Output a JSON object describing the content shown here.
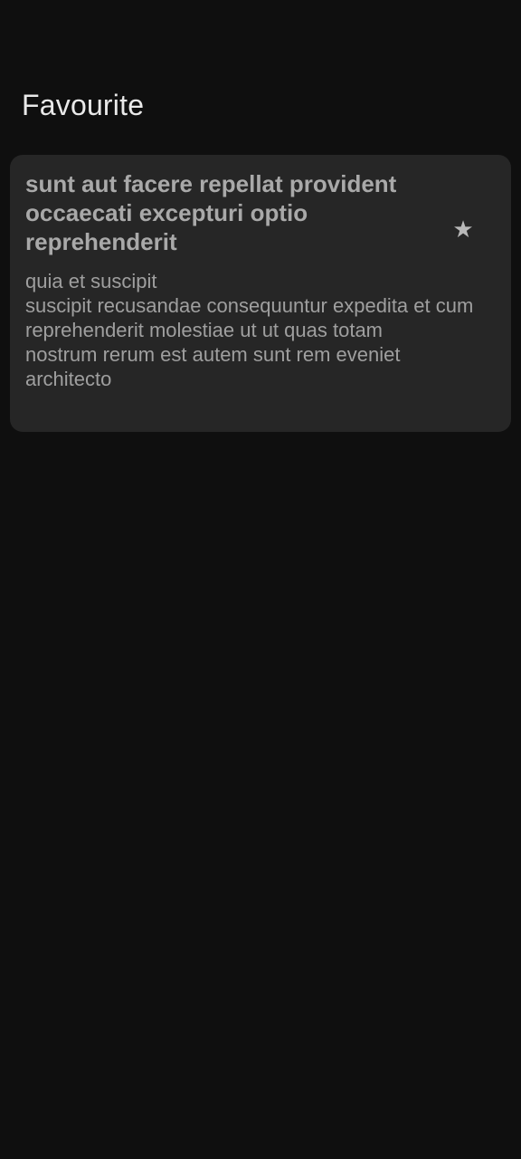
{
  "header": {
    "title": "Favourite"
  },
  "cards": [
    {
      "title": "sunt aut facere repellat provident occaecati excepturi optio reprehenderit",
      "body": "quia et suscipit\nsuscipit recusandae consequuntur expedita et cum\nreprehenderit molestiae ut ut quas totam\nnostrum rerum est autem sunt rem eveniet architecto",
      "star_icon": "★",
      "star_icon_name": "star-icon"
    }
  ],
  "colors": {
    "background": "#0f0f0f",
    "card": "#262626",
    "title_text": "#e9e9e9",
    "card_title_text": "#a9a9a9",
    "card_body_text": "#9f9f9f",
    "icon": "#b8b8b8"
  }
}
